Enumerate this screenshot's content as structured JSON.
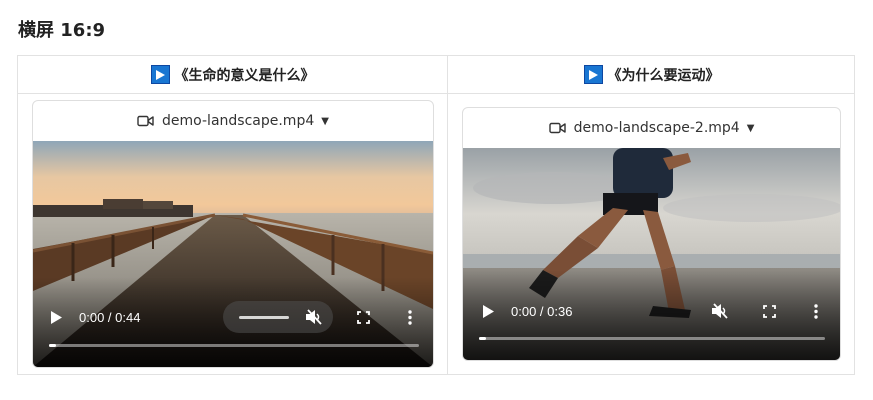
{
  "page": {
    "title": "横屏 16:9"
  },
  "columns": [
    {
      "title": "《生命的意义是什么》",
      "file_name": "demo-landscape.mp4",
      "time_display": "0:00 / 0:44",
      "progress": 0.0
    },
    {
      "title": "《为什么要运动》",
      "file_name": "demo-landscape-2.mp4",
      "time_display": "0:00 / 0:36",
      "progress": 0.0
    }
  ],
  "colors": {
    "badge": "#1976d2",
    "border": "#e2e2e2"
  },
  "icons": {
    "header": "play-square-icon",
    "file": "video-camera-icon",
    "dropdown": "caret-down-icon",
    "controls": [
      "play-icon",
      "mute-icon",
      "fullscreen-icon",
      "more-vert-icon"
    ]
  }
}
